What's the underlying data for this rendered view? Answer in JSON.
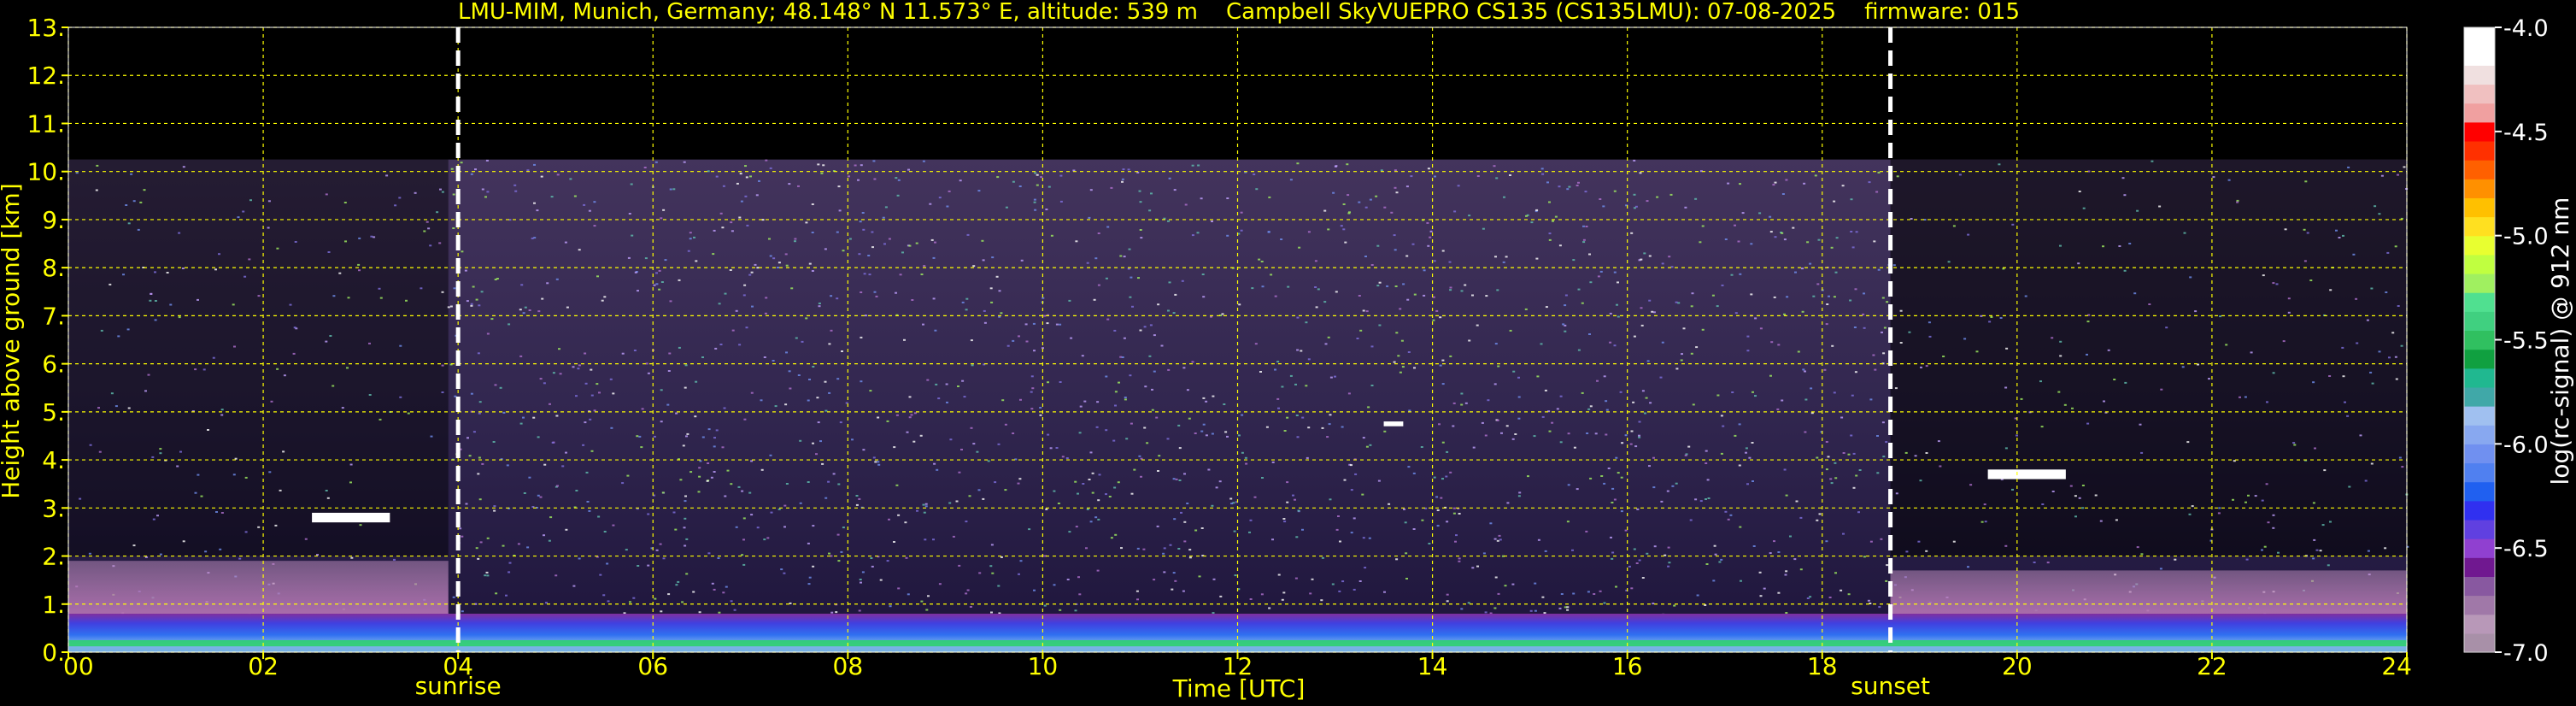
{
  "chart_data": {
    "type": "heatmap",
    "title": "LMU-MIM, Munich, Germany; 48.148° N 11.573° E, altitude: 539 m    Campbell SkyVUEPRO CS135 (CS135LMU): 07-08-2025    firmware: 015",
    "xlabel": "Time [UTC]",
    "ylabel": "Height above ground [km]",
    "xlim": [
      0,
      24
    ],
    "ylim": [
      0,
      13
    ],
    "x_ticks": [
      "00",
      "02",
      "04",
      "06",
      "08",
      "10",
      "12",
      "14",
      "16",
      "18",
      "20",
      "22",
      "24"
    ],
    "y_ticks": [
      "0.",
      "1.",
      "2.",
      "3.",
      "4.",
      "5.",
      "6.",
      "7.",
      "8.",
      "9.",
      "10.",
      "11.",
      "12.",
      "13."
    ],
    "grid": true,
    "grid_color": "#ffff00",
    "events": [
      {
        "label": "sunrise",
        "x": 4.0
      },
      {
        "label": "sunset",
        "x": 18.7
      }
    ],
    "data_top_height_km": 10.25,
    "colorbar": {
      "label": "log(rc-signal) @ 912 nm",
      "range": [
        -7.0,
        -4.0
      ],
      "ticks": [
        "-4.0",
        "-4.5",
        "-5.0",
        "-5.5",
        "-6.0",
        "-6.5",
        "-7.0"
      ],
      "colors": [
        "#a890a8",
        "#b898b8",
        "#a078a8",
        "#8858a0",
        "#701890",
        "#9040d0",
        "#6040e0",
        "#3030f0",
        "#2060f0",
        "#5080f0",
        "#7090f0",
        "#88a8f0",
        "#a0c0f0",
        "#40a8a8",
        "#20b890",
        "#10a040",
        "#30c060",
        "#40d080",
        "#50e090",
        "#a0f060",
        "#c0ff40",
        "#e8ff30",
        "#ffe020",
        "#ffc000",
        "#ff9000",
        "#ff6000",
        "#ff3000",
        "#ff0000",
        "#f0a0a0",
        "#f0c0c0",
        "#f0e0e0",
        "#ffffff",
        "#ffffff"
      ]
    },
    "features": [
      {
        "name": "surface aerosol layer",
        "height_range_km": [
          0.0,
          0.8
        ],
        "time_range_h": [
          0,
          24
        ]
      },
      {
        "name": "residual layer",
        "height_range_km": [
          0.8,
          1.9
        ],
        "time_range_h": [
          0,
          3.9
        ]
      },
      {
        "name": "residual layer",
        "height_range_km": [
          0.8,
          1.7
        ],
        "time_range_h": [
          18.7,
          24
        ]
      },
      {
        "name": "cloud",
        "height_range_km": [
          2.7,
          2.9
        ],
        "time_range_h": [
          2.5,
          3.3
        ]
      },
      {
        "name": "cloud",
        "height_range_km": [
          4.7,
          4.8
        ],
        "time_range_h": [
          13.5,
          13.7
        ]
      },
      {
        "name": "cloud",
        "height_range_km": [
          3.6,
          3.8
        ],
        "time_range_h": [
          19.7,
          20.5
        ]
      }
    ]
  }
}
